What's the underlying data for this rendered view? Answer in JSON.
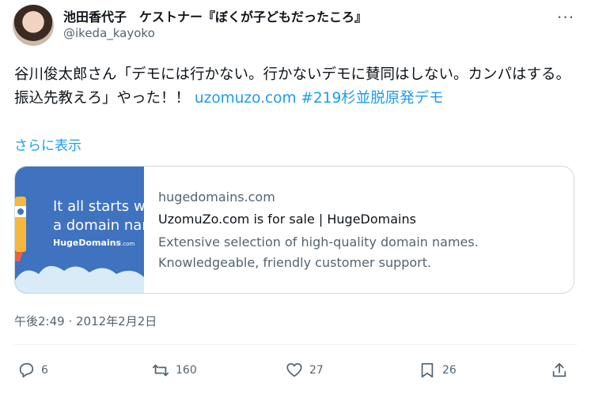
{
  "author": {
    "display_name": "池田香代子　ケストナー『ぼくが子どもだったころ』",
    "handle": "@ikeda_kayoko"
  },
  "more_icon": "more-horizontal-icon",
  "tweet": {
    "text": "谷川俊太郎さん「デモには行かない。行かないデモに賛同はしない。カンパはする。振込先教えろ」やった！！",
    "link": "uzomuzo.com",
    "hashtag": "#219杉並脱原発デモ",
    "show_more": "さらに表示"
  },
  "card": {
    "image_line1": "It all starts w",
    "image_line2": "a domain nam",
    "image_logo": "HugeDomains",
    "image_logo_suffix": ".com",
    "domain": "hugedomains.com",
    "title": "UzomuZo.com is for sale | HugeDomains",
    "description_line1": "Extensive selection of high-quality domain names.",
    "description_line2": "Knowledgeable, friendly customer support."
  },
  "timestamp": "午後2:49 · 2012年2月2日",
  "actions": {
    "replies": "6",
    "retweets": "160",
    "likes": "27",
    "bookmarks": "26"
  },
  "colors": {
    "link": "#1d9bf0",
    "secondary_text": "#536471",
    "card_image_bg": "#3f72bf"
  }
}
